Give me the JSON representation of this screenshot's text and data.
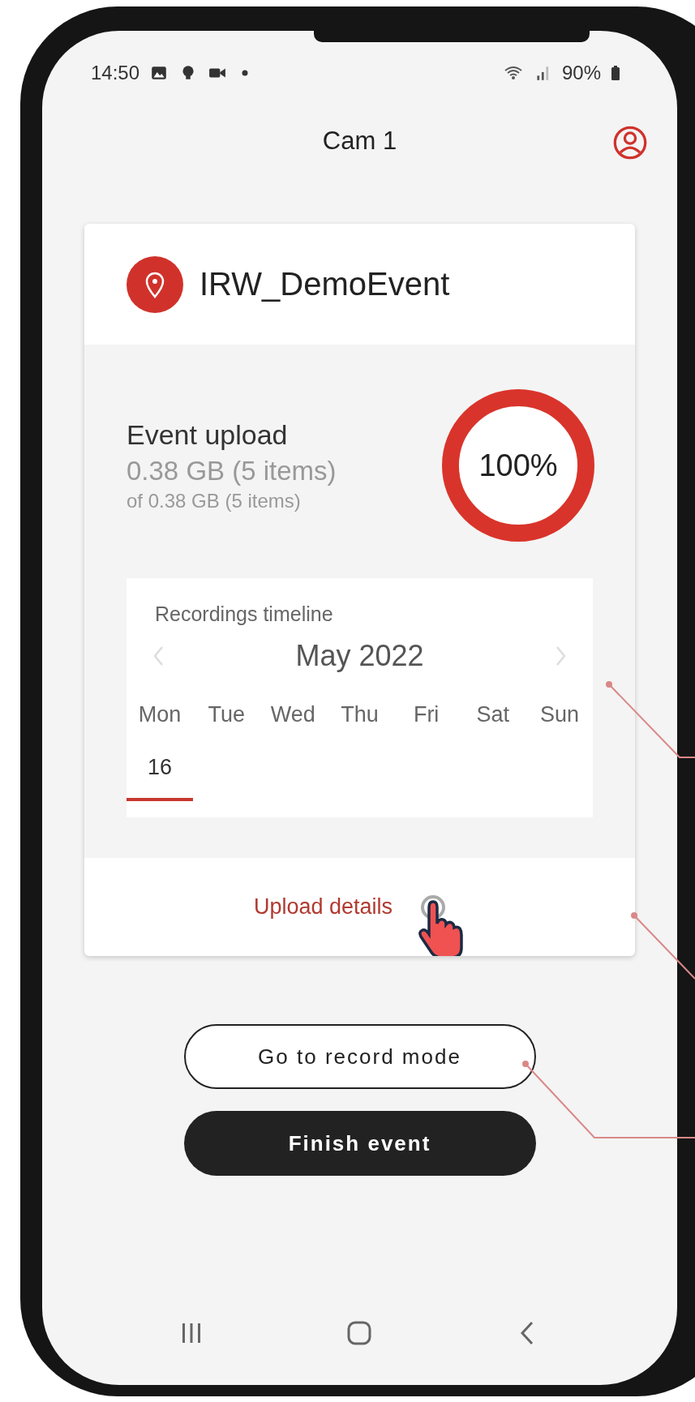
{
  "status_bar": {
    "time": "14:50",
    "battery": "90%"
  },
  "header": {
    "title": "Cam 1"
  },
  "event_card": {
    "name": "IRW_DemoEvent",
    "upload": {
      "title": "Event upload",
      "uploaded": "0.38 GB (5 items)",
      "total": "of 0.38 GB (5 items)",
      "percent": "100%",
      "level": 1
    },
    "timeline": {
      "title": "Recordings timeline",
      "month": "May 2022",
      "weekdays": [
        "Mon",
        "Tue",
        "Wed",
        "Thu",
        "Fri",
        "Sat",
        "Sun"
      ],
      "dates": [
        {
          "label": "16",
          "selected": true
        }
      ]
    },
    "details_link": "Upload details"
  },
  "buttons": [
    {
      "label": "Go to record mode",
      "kind": "outline"
    },
    {
      "label": "Finish event",
      "kind": "filled"
    }
  ]
}
